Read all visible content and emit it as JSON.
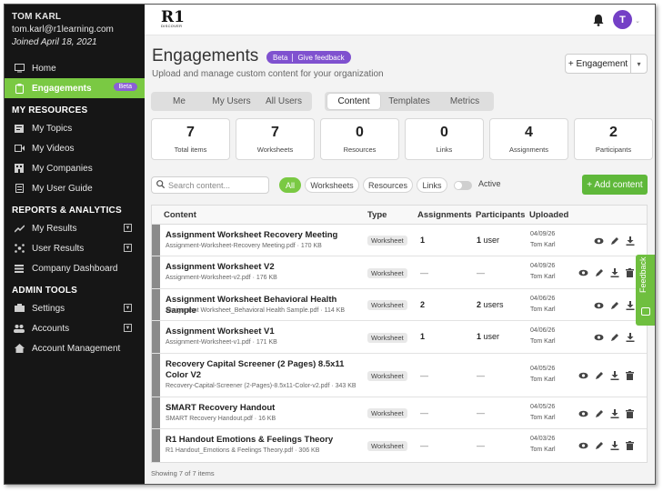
{
  "user": {
    "name": "TOM KARL",
    "email": "tom.karl@r1learning.com",
    "joined": "Joined April 18, 2021"
  },
  "sidebar": {
    "items": [
      {
        "label": "Home",
        "icon": "monitor-icon"
      },
      {
        "label": "Engagements",
        "icon": "clipboard-icon",
        "badge": "Beta"
      }
    ],
    "sections": [
      {
        "title": "MY RESOURCES",
        "items": [
          {
            "label": "My Topics",
            "icon": "topics-icon"
          },
          {
            "label": "My Videos",
            "icon": "video-icon"
          },
          {
            "label": "My Companies",
            "icon": "building-icon"
          },
          {
            "label": "My User Guide",
            "icon": "guide-icon"
          }
        ]
      },
      {
        "title": "REPORTS & ANALYTICS",
        "items": [
          {
            "label": "My Results",
            "icon": "chart-icon"
          },
          {
            "label": "User Results",
            "icon": "network-icon"
          },
          {
            "label": "Company Dashboard",
            "icon": "dashboard-icon"
          }
        ]
      },
      {
        "title": "ADMIN TOOLS",
        "items": [
          {
            "label": "Settings",
            "icon": "gear-icon"
          },
          {
            "label": "Accounts",
            "icon": "users-icon"
          },
          {
            "label": "Account Management",
            "icon": "account-icon"
          }
        ]
      }
    ]
  },
  "topbar": {
    "logo_text": "R1",
    "logo_sub": "DISCOVER",
    "avatar_letter": "T"
  },
  "header": {
    "title": "Engagements",
    "pill_beta": "Beta",
    "pill_feedback": "Give feedback",
    "subtitle": "Upload and manage custom content for your organization",
    "new_button": "+ Engagement"
  },
  "tabs_scope": [
    "Me",
    "My Users",
    "All Users"
  ],
  "tabs_view": [
    "Content",
    "Templates",
    "Metrics"
  ],
  "stats": [
    {
      "value": "7",
      "label": "Total items"
    },
    {
      "value": "7",
      "label": "Worksheets"
    },
    {
      "value": "0",
      "label": "Resources"
    },
    {
      "value": "0",
      "label": "Links"
    },
    {
      "value": "4",
      "label": "Assignments"
    },
    {
      "value": "2",
      "label": "Participants"
    }
  ],
  "filters": {
    "search_placeholder": "Search content...",
    "chips": [
      "All",
      "Worksheets",
      "Resources",
      "Links"
    ],
    "active_label": "Active",
    "add_button": "+ Add content"
  },
  "table": {
    "headers": [
      "Content",
      "Type",
      "Assignments",
      "Participants",
      "Uploaded"
    ],
    "rows": [
      {
        "title": "Assignment Worksheet Recovery Meeting",
        "file": "Assignment-Worksheet-Recovery Meeting.pdf · 170 KB",
        "type": "Worksheet",
        "assignments": "1",
        "participants_num": "1",
        "participants_unit": " user",
        "date": "04/09/26",
        "by": "Tom Karl"
      },
      {
        "title": "Assignment Worksheet V2",
        "file": "Assignment-Worksheet-v2.pdf · 176 KB",
        "type": "Worksheet",
        "assignments": "—",
        "participants_num": "—",
        "participants_unit": "",
        "date": "04/09/26",
        "by": "Tom Karl"
      },
      {
        "title": "Assignment Worksheet Behavioral Health Sample",
        "file": "Assignment Worksheet_Behavioral Health Sample.pdf · 114 KB",
        "type": "Worksheet",
        "assignments": "2",
        "participants_num": "2",
        "participants_unit": " users",
        "date": "04/06/26",
        "by": "Tom Karl"
      },
      {
        "title": "Assignment Worksheet V1",
        "file": "Assignment-Worksheet-v1.pdf · 171 KB",
        "type": "Worksheet",
        "assignments": "1",
        "participants_num": "1",
        "participants_unit": " user",
        "date": "04/06/26",
        "by": "Tom Karl"
      },
      {
        "title": "Recovery Capital Screener (2 Pages) 8.5x11 Color V2",
        "file": "Recovery-Capital-Screener (2-Pages)-8.5x11-Color-v2.pdf · 343 KB",
        "type": "Worksheet",
        "assignments": "—",
        "participants_num": "—",
        "participants_unit": "",
        "date": "04/05/26",
        "by": "Tom Karl"
      },
      {
        "title": "SMART Recovery Handout",
        "file": "SMART Recovery Handout.pdf · 16 KB",
        "type": "Worksheet",
        "assignments": "—",
        "participants_num": "—",
        "participants_unit": "",
        "date": "04/05/26",
        "by": "Tom Karl"
      },
      {
        "title": "R1 Handout Emotions & Feelings Theory",
        "file": "R1 Handout_Emotions & Feelings Theory.pdf · 306 KB",
        "type": "Worksheet",
        "assignments": "—",
        "participants_num": "—",
        "participants_unit": "",
        "date": "04/03/26",
        "by": "Tom Karl"
      }
    ],
    "footer": "Showing 7 of 7 items"
  },
  "feedback_tab": "Feedback",
  "colors": {
    "accent_green": "#7ac943",
    "brand_purple": "#7f51cf",
    "sidebar_bg": "#161616"
  }
}
